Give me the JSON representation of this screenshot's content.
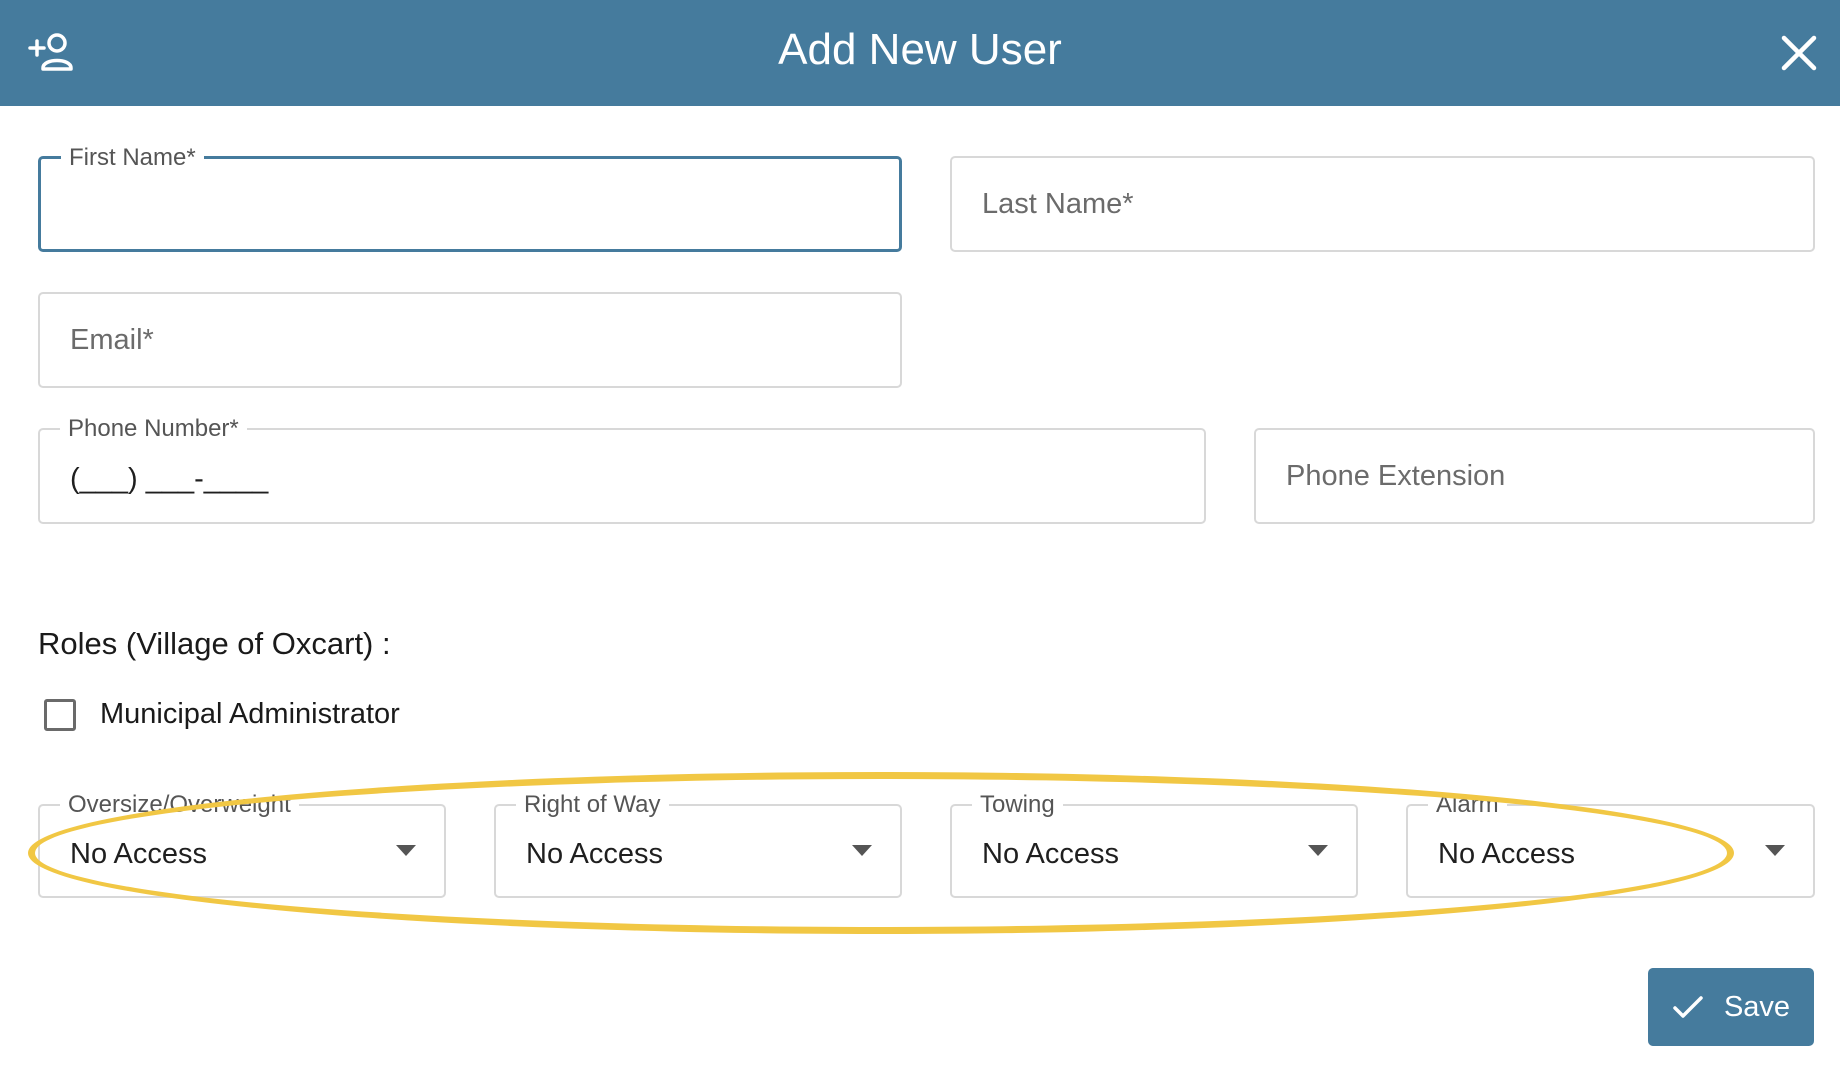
{
  "dialog": {
    "title": "Add New User"
  },
  "fields": {
    "first_name": {
      "label": "First Name*",
      "value": ""
    },
    "last_name": {
      "placeholder": "Last Name*"
    },
    "email": {
      "placeholder": "Email*"
    },
    "phone_number": {
      "label": "Phone Number*",
      "value": "(___) ___-____"
    },
    "phone_extension": {
      "placeholder": "Phone Extension"
    }
  },
  "roles": {
    "title": "Roles (Village of Oxcart) :",
    "municipal_admin": {
      "label": "Municipal Administrator",
      "checked": false
    },
    "selects": [
      {
        "label": "Oversize/Overweight",
        "value": "No Access"
      },
      {
        "label": "Right of Way",
        "value": "No Access"
      },
      {
        "label": "Towing",
        "value": "No Access"
      },
      {
        "label": "Alarm",
        "value": "No Access"
      }
    ]
  },
  "actions": {
    "save_label": "Save"
  },
  "colors": {
    "header": "#457b9d",
    "highlight": "#f1c744",
    "button": "#457b9d"
  },
  "icons": {
    "header": "add-user-icon",
    "close": "close-icon",
    "save": "check-icon",
    "select": "caret-down-icon"
  }
}
